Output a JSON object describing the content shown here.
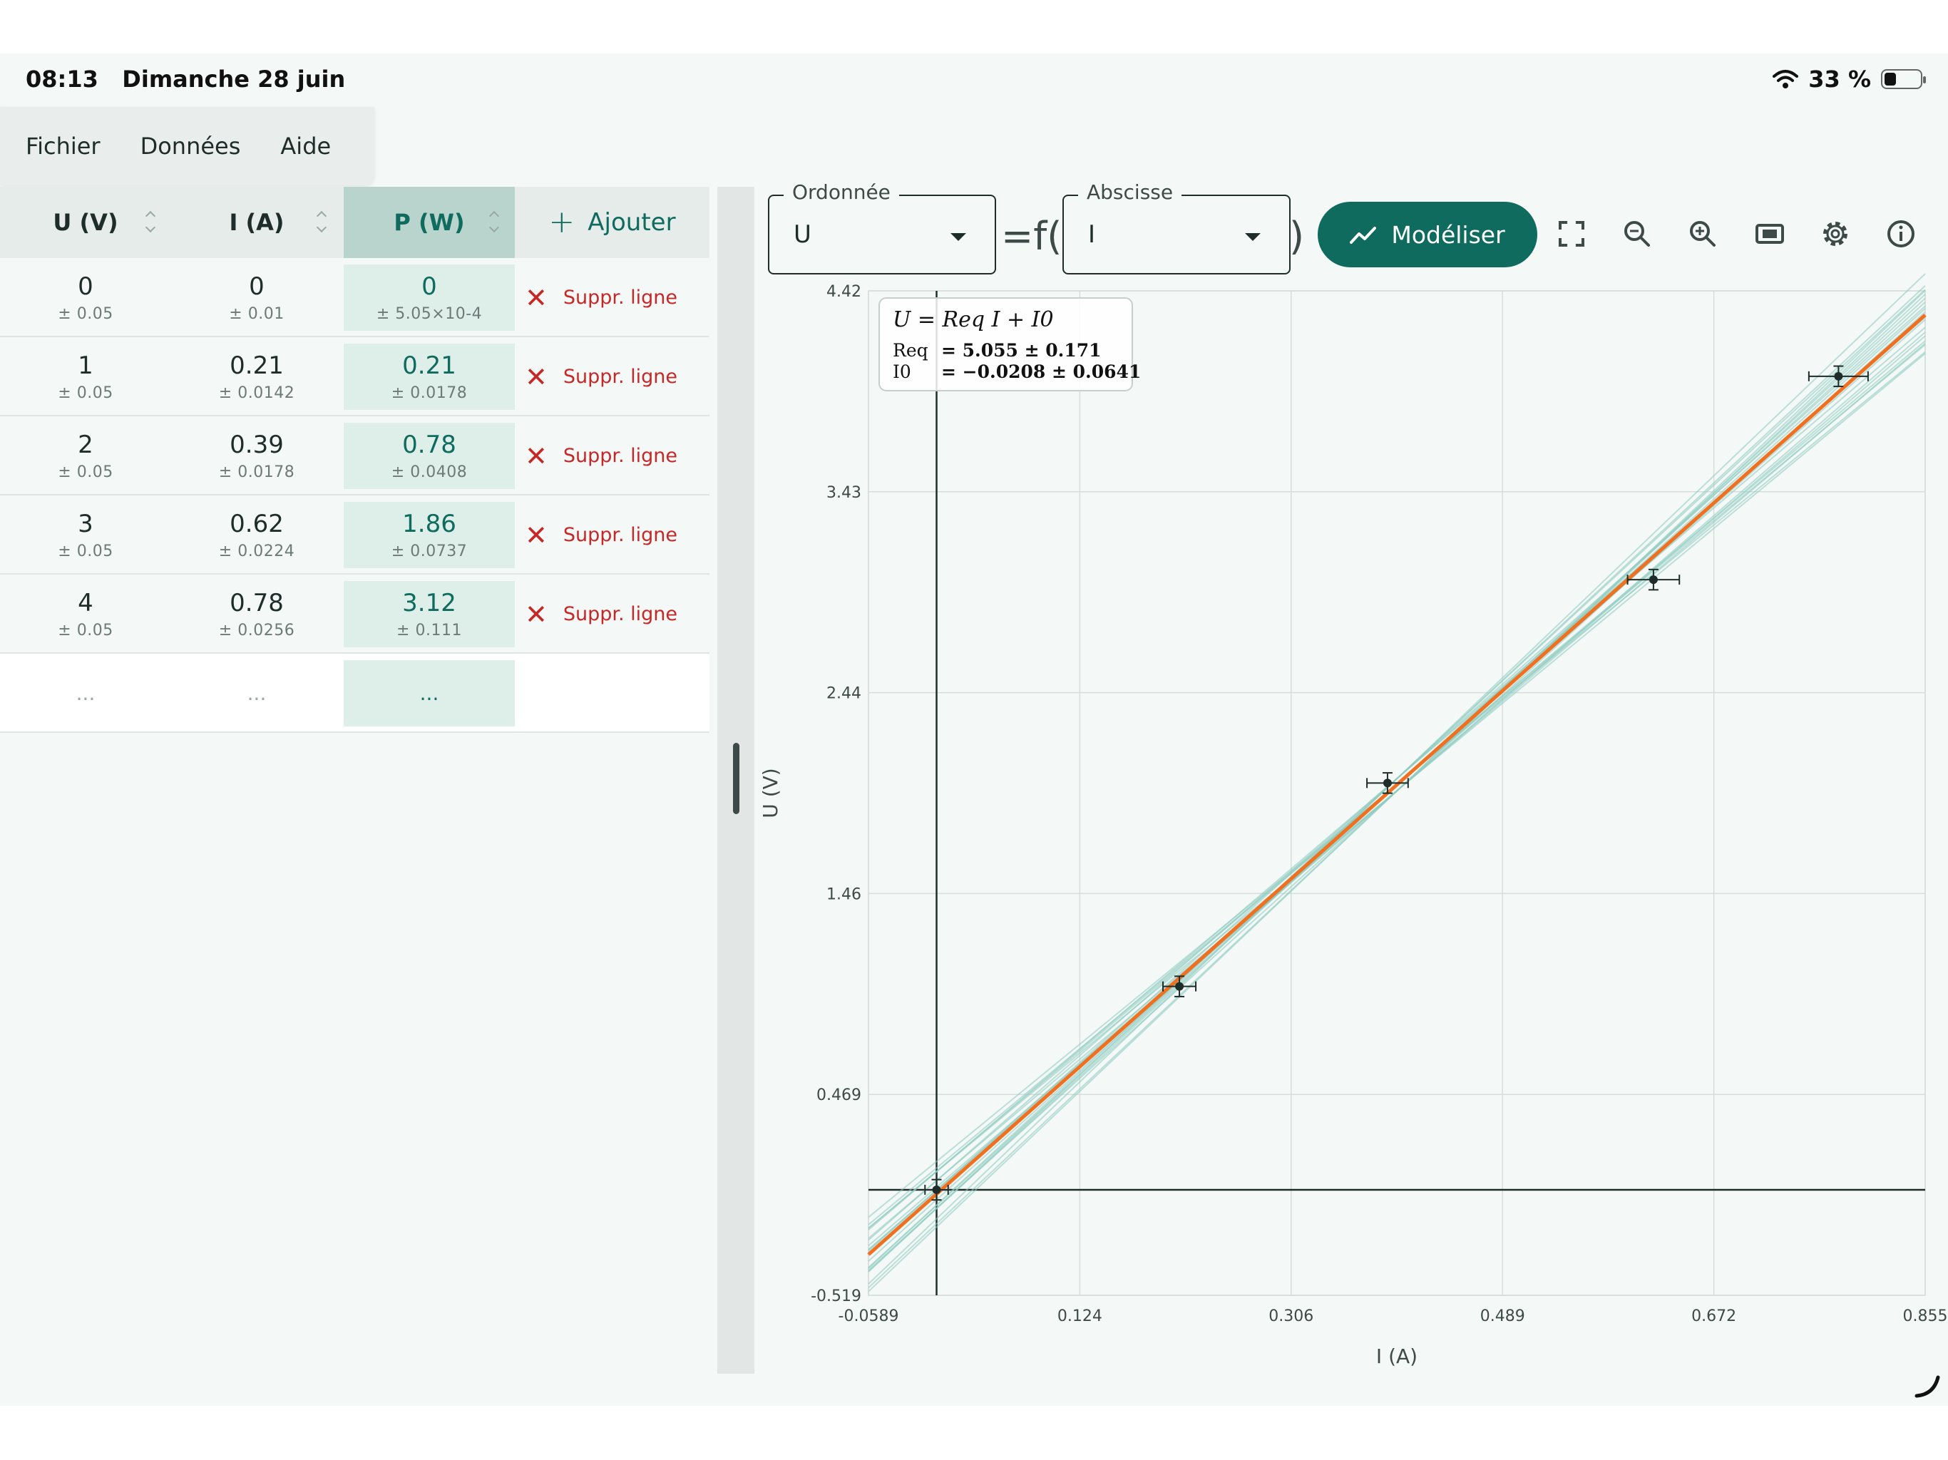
{
  "status": {
    "time": "08:13",
    "date": "Dimanche 28 juin",
    "battery": "33 %",
    "battery_level": 0.33
  },
  "menu": {
    "file": "Fichier",
    "data": "Données",
    "help": "Aide"
  },
  "table": {
    "headers": {
      "u": "U (V)",
      "i": "I (A)",
      "p": "P (W)"
    },
    "add_label": "Ajouter",
    "delete_label": "Suppr. ligne",
    "rows": [
      {
        "u": "0",
        "u_unc": "± 0.05",
        "i": "0",
        "i_unc": "± 0.01",
        "p": "0",
        "p_unc": "± 5.05×10-4"
      },
      {
        "u": "1",
        "u_unc": "± 0.05",
        "i": "0.21",
        "i_unc": "± 0.0142",
        "p": "0.21",
        "p_unc": "± 0.0178"
      },
      {
        "u": "2",
        "u_unc": "± 0.05",
        "i": "0.39",
        "i_unc": "± 0.0178",
        "p": "0.78",
        "p_unc": "± 0.0408"
      },
      {
        "u": "3",
        "u_unc": "± 0.05",
        "i": "0.62",
        "i_unc": "± 0.0224",
        "p": "1.86",
        "p_unc": "± 0.0737"
      },
      {
        "u": "4",
        "u_unc": "± 0.05",
        "i": "0.78",
        "i_unc": "± 0.0256",
        "p": "3.12",
        "p_unc": "± 0.111"
      }
    ],
    "empty_row": {
      "u": "...",
      "i": "...",
      "p": "..."
    }
  },
  "toolbar": {
    "ordinate_label": "Ordonnée",
    "ordinate_value": "U",
    "eq_text": "=f(",
    "abscissa_label": "Abscisse",
    "abscissa_value": "I",
    "close_paren": ")",
    "model_label": "Modéliser"
  },
  "colors": {
    "accent": "#0e6b5e",
    "fit_line": "#f07020",
    "mc_lines": "#8ccbc0",
    "delete": "#c62828"
  },
  "chart_data": {
    "type": "scatter",
    "xlabel": "I (A)",
    "ylabel": "U (V)",
    "xlim": [
      -0.0589,
      0.855
    ],
    "ylim": [
      -0.519,
      4.42
    ],
    "x_ticks": [
      "-0.0589",
      "0.124",
      "0.306",
      "0.489",
      "0.672",
      "0.855"
    ],
    "y_ticks": [
      "-0.519",
      "0.469",
      "1.46",
      "2.44",
      "3.43",
      "4.42"
    ],
    "grid": true,
    "points": [
      {
        "x": 0,
        "y": 0,
        "xerr": 0.01,
        "yerr": 0.05
      },
      {
        "x": 0.21,
        "y": 1,
        "xerr": 0.0142,
        "yerr": 0.05
      },
      {
        "x": 0.39,
        "y": 2,
        "xerr": 0.0178,
        "yerr": 0.05
      },
      {
        "x": 0.62,
        "y": 3,
        "xerr": 0.0224,
        "yerr": 0.05
      },
      {
        "x": 0.78,
        "y": 4,
        "xerr": 0.0256,
        "yerr": 0.05
      }
    ],
    "fit": {
      "slope": 5.055,
      "intercept": -0.0208
    },
    "fit_legend": {
      "formula": "U = Req I + I0",
      "line1_name": "Req",
      "line1_value": "= 5.055 ± 0.171",
      "line2_name": "I0",
      "line2_value": "= −0.0208 ± 0.0641"
    }
  }
}
